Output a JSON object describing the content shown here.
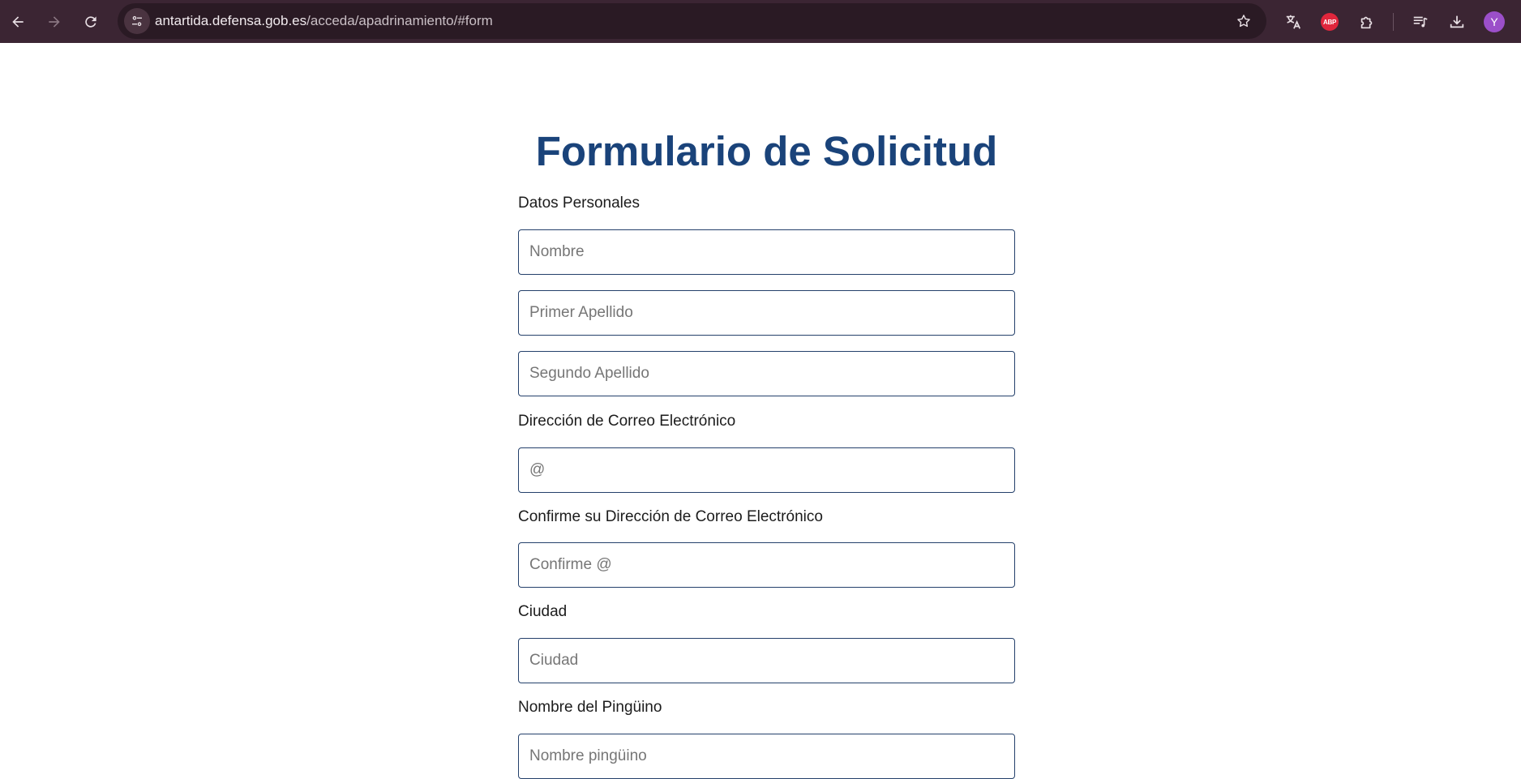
{
  "browser": {
    "url_host": "antartida.defensa.gob.es",
    "url_path": "/acceda/apadrinamiento/#form",
    "profile_initial": "Y",
    "adblock_label": "ABP",
    "accent_color": "#3b2533"
  },
  "form": {
    "title": "Formulario de Solicitud",
    "personal_label": "Datos Personales",
    "nombre_placeholder": "Nombre",
    "primer_apellido_placeholder": "Primer Apellido",
    "segundo_apellido_placeholder": "Segundo Apellido",
    "email_label": "Dirección de Correo Electrónico",
    "email_placeholder": "@",
    "email_confirm_label": "Confirme su Dirección de Correo Electrónico",
    "email_confirm_placeholder": "Confirme @",
    "city_label": "Ciudad",
    "city_placeholder": "Ciudad",
    "penguin_label": "Nombre del Pingüino",
    "penguin_placeholder": "Nombre pingüino",
    "title_color": "#1a437a",
    "border_color": "#24406b"
  }
}
